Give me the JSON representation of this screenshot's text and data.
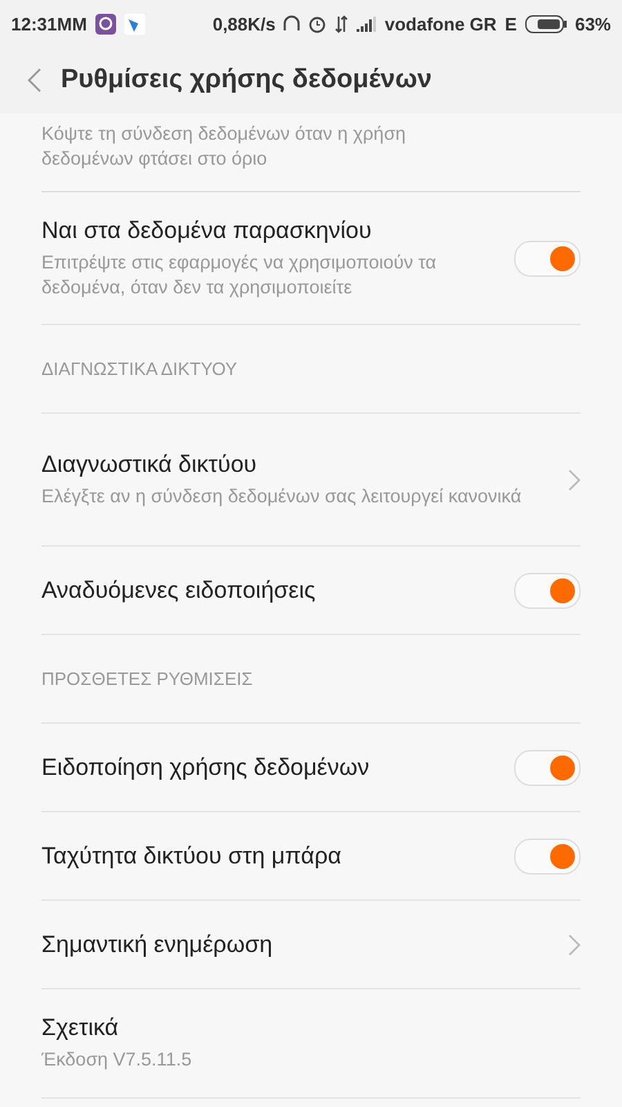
{
  "status_bar": {
    "time": "12:31MM",
    "speed": "0,88K/s",
    "carrier": "vodafone GR",
    "network": "E",
    "battery": "63%"
  },
  "header": {
    "title": "Ρυθμίσεις χρήσης δεδομένων"
  },
  "rows": [
    {
      "kind": "cut",
      "subtitle_lines": [
        "Κόψτε τη σύνδεση δεδομένων όταν η χρήση",
        "δεδομένων φτάσει στο όριο"
      ]
    },
    {
      "kind": "toggle",
      "title": "Ναι στα δεδομένα παρασκηνίου",
      "subtitle": "Επιτρέψτε στις εφαρμογές να χρησιμοποιούν τα δεδομένα, όταν δεν τα χρησιμοποιείτε",
      "on": true
    },
    {
      "kind": "section",
      "title": "ΔΙΑΓΝΩΣΤΙΚΑ ΔΙΚΤΥΟΥ"
    },
    {
      "kind": "link",
      "title": "Διαγνωστικά δικτύου",
      "subtitle": "Ελέγξτε αν η σύνδεση δεδομένων σας λειτουργεί κανονικά"
    },
    {
      "kind": "toggle",
      "title": "Αναδυόμενες ειδοποιήσεις",
      "on": true
    },
    {
      "kind": "section",
      "title": "ΠΡΟΣΘΕΤΕΣ ΡΥΘΜΙΣΕΙΣ"
    },
    {
      "kind": "toggle",
      "title": "Ειδοποίηση χρήσης δεδομένων",
      "on": true
    },
    {
      "kind": "toggle",
      "title": "Ταχύτητα δικτύου στη μπάρα",
      "on": true
    },
    {
      "kind": "link",
      "title": "Σημαντική ενημέρωση"
    },
    {
      "kind": "info",
      "title": "Σχετικά",
      "subtitle": "Έκδοση V7.5.11.5"
    }
  ]
}
